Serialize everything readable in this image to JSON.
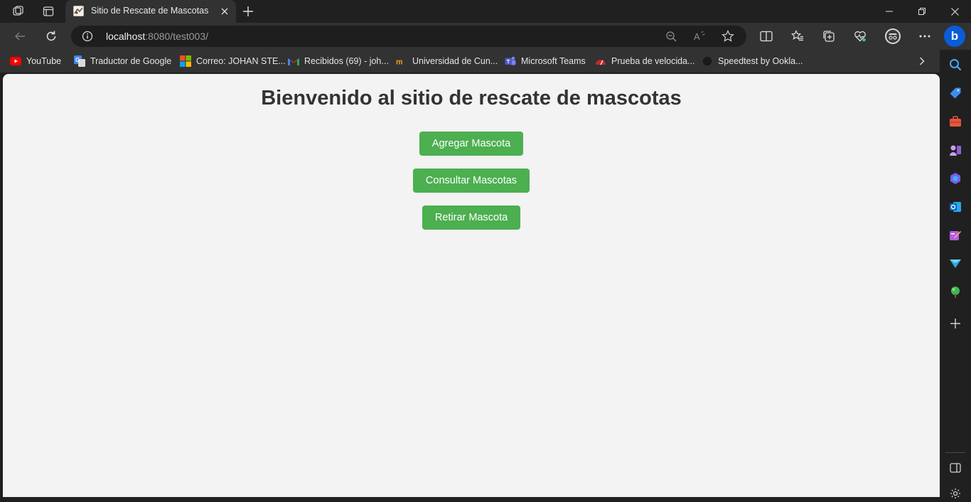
{
  "browser": {
    "tab": {
      "title": "Sitio de Rescate de Mascotas"
    },
    "address": {
      "host": "localhost",
      "path": ":8080/test003/"
    },
    "favorites": [
      {
        "label": "YouTube",
        "icon": "youtube-icon"
      },
      {
        "label": "Traductor de Google",
        "icon": "google-translate-icon"
      },
      {
        "label": "Correo: JOHAN STE...",
        "icon": "microsoft-icon"
      },
      {
        "label": "Recibidos (69) - joh...",
        "icon": "gmail-icon"
      },
      {
        "label": "Universidad de Cun...",
        "icon": "university-icon"
      },
      {
        "label": "Microsoft Teams",
        "icon": "teams-icon"
      },
      {
        "label": "Prueba de velocida...",
        "icon": "speed-test-icon"
      },
      {
        "label": "Speedtest by Ookla...",
        "icon": "speedtest-icon"
      }
    ],
    "sidebar_icons": [
      "search-icon",
      "tag-icon",
      "toolbox-icon",
      "games-icon",
      "office-icon",
      "outlook-icon",
      "designer-icon",
      "send-icon",
      "tree-icon",
      "add-icon"
    ]
  },
  "page": {
    "heading": "Bienvenido al sitio de rescate de mascotas",
    "buttons": {
      "add": "Agregar Mascota",
      "query": "Consultar Mascotas",
      "remove": "Retirar Mascota"
    }
  },
  "colors": {
    "button_green": "#4caf50",
    "page_background": "#f3f3f3",
    "heading_text": "#333333"
  }
}
